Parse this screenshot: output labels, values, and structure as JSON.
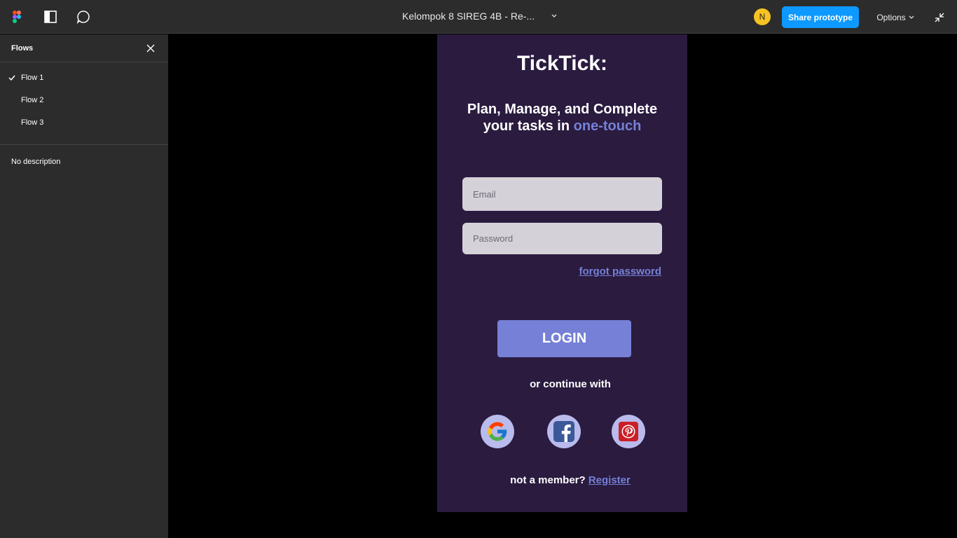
{
  "toolbar": {
    "file_title": "Kelompok 8 SIREG 4B - Re-...",
    "avatar_initial": "N",
    "share_label": "Share prototype",
    "options_label": "Options"
  },
  "sidebar": {
    "title": "Flows",
    "flows": [
      {
        "label": "Flow 1",
        "selected": true
      },
      {
        "label": "Flow 2",
        "selected": false
      },
      {
        "label": "Flow 3",
        "selected": false
      }
    ],
    "description": "No description"
  },
  "app": {
    "title": "TickTick:",
    "tagline_line1": "Plan, Manage, and Complete",
    "tagline_line2_prefix": "your tasks in ",
    "tagline_accent": "one-touch",
    "email_placeholder": "Email",
    "password_placeholder": "Password",
    "forgot_label": "forgot password",
    "login_label": "LOGIN",
    "continue_label": "or continue with",
    "member_prefix": "not a member? ",
    "register_label": "Register"
  },
  "colors": {
    "toolbar_bg": "#2c2c2c",
    "share_blue": "#0d99ff",
    "phone_bg": "#2a1b3f",
    "accent": "#7680d6"
  }
}
